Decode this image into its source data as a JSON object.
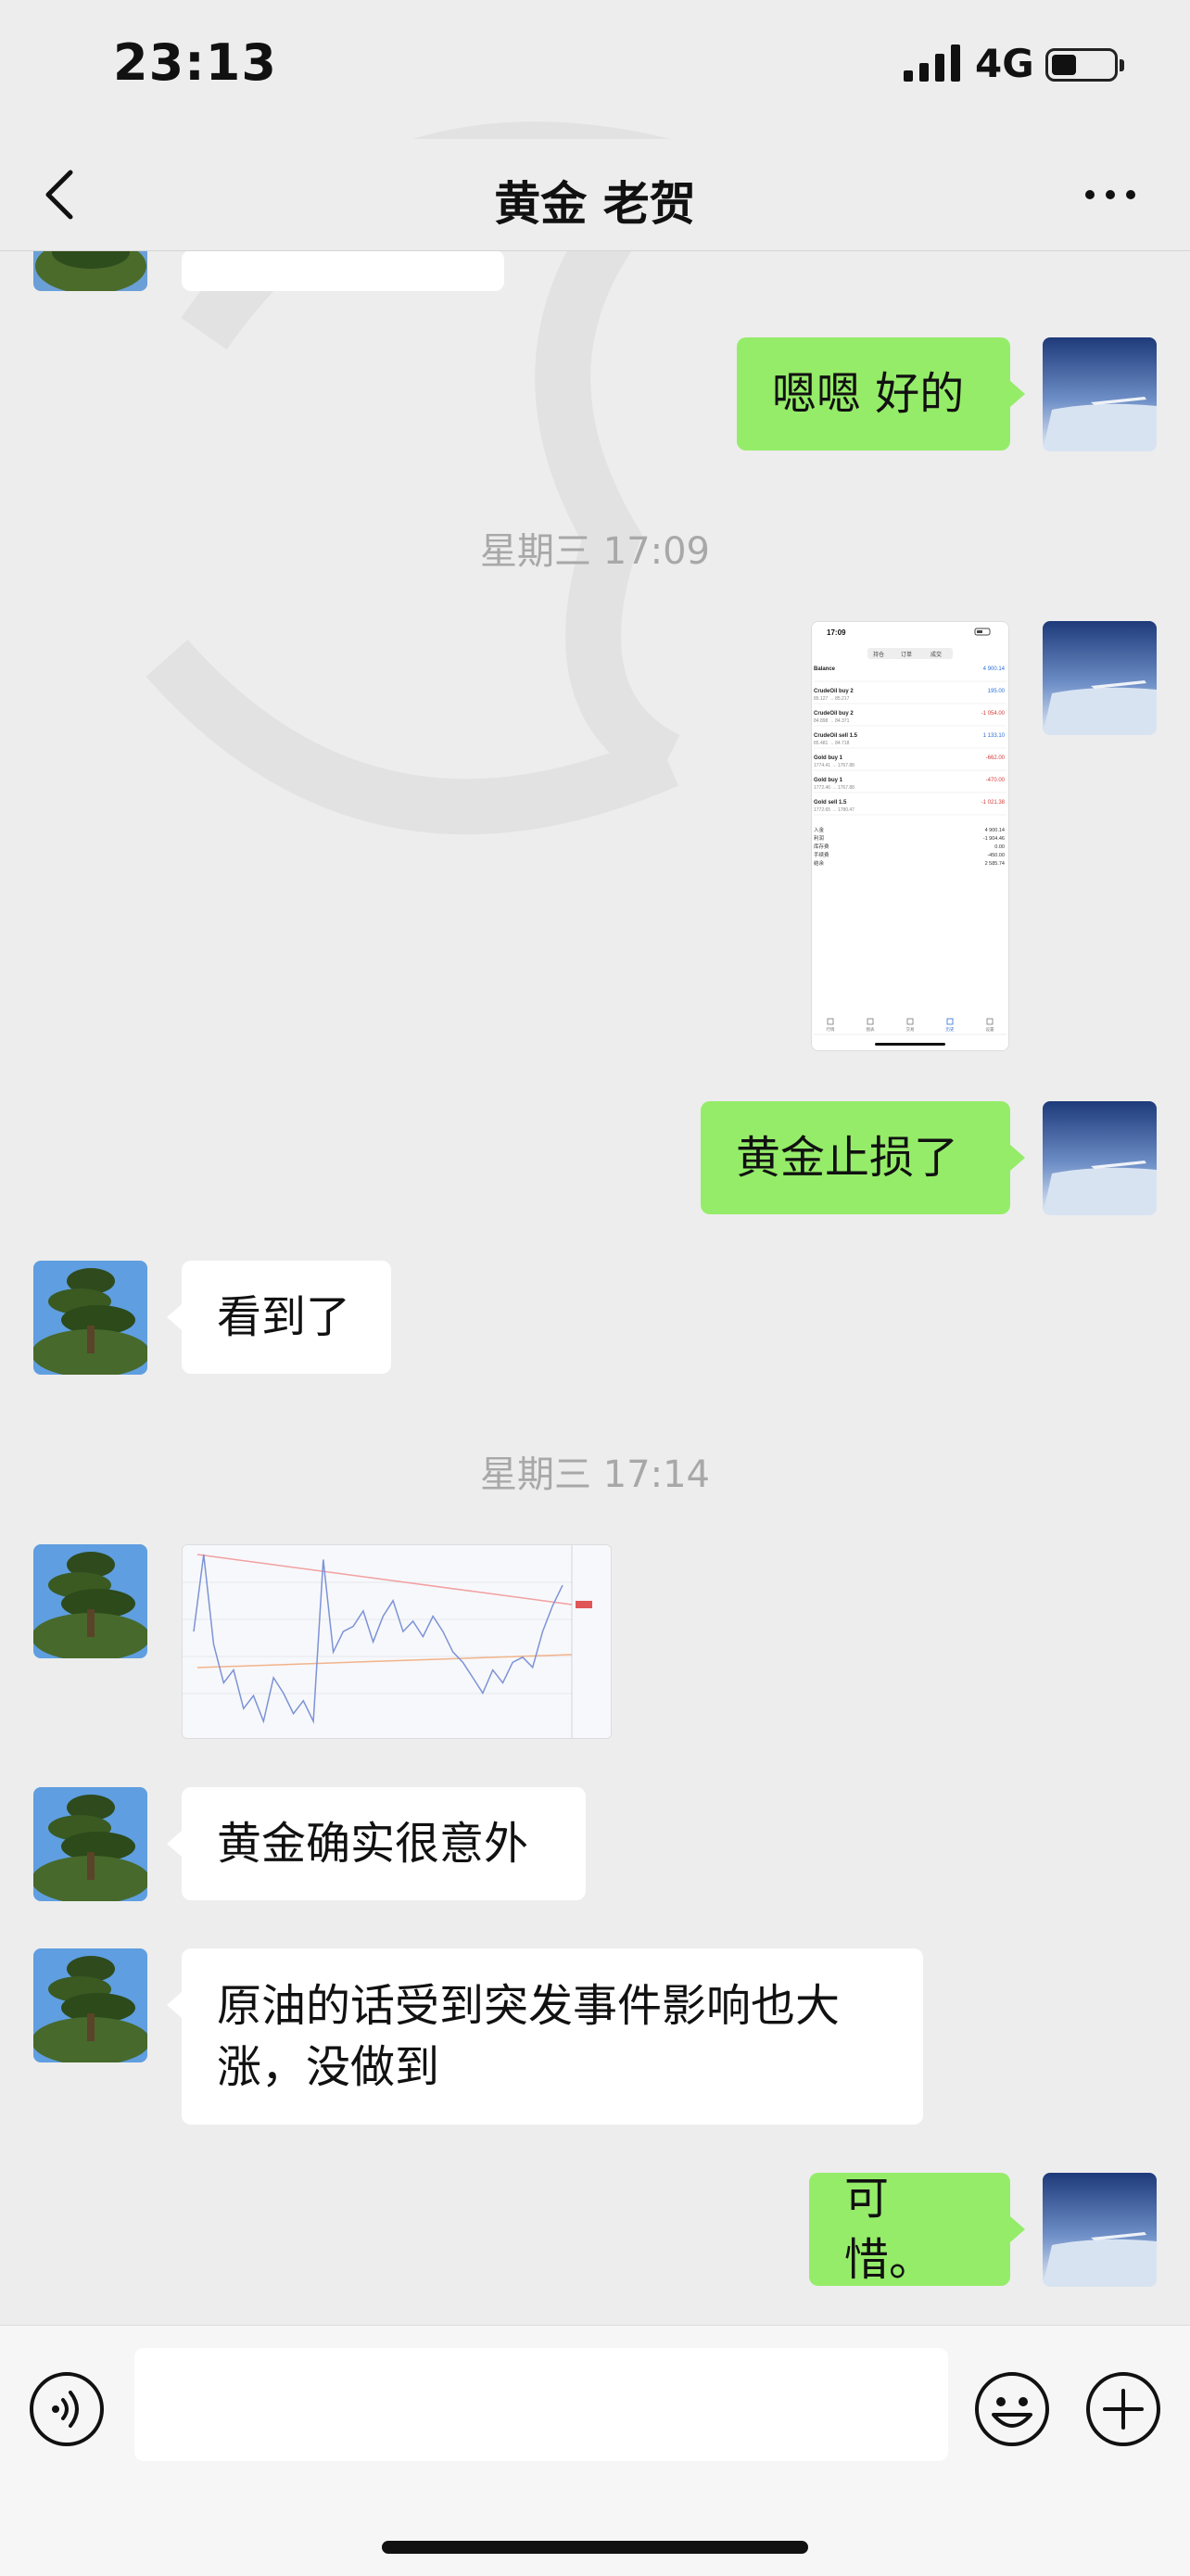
{
  "status": {
    "time": "23:13",
    "network": "4G"
  },
  "nav": {
    "title": "黄金 老贺"
  },
  "messages": {
    "m1": "嗯嗯 好的",
    "t1": "星期三 17:09",
    "m3": "黄金止损了",
    "m4": "看到了",
    "t2": "星期三 17:14",
    "m6": "黄金确实很意外",
    "m7": "原油的话受到突发事件影响也大涨，没做到",
    "m8": "可惜。"
  },
  "screenshot": {
    "time": "17:09",
    "tabs": [
      "持仓",
      "订单",
      "成交"
    ],
    "rows": [
      {
        "name": "Balance",
        "sub": "",
        "val": "4 900.14"
      },
      {
        "name": "CrudeOil buy 2",
        "sub": "85.127 → 85.217",
        "val": "195.00"
      },
      {
        "name": "CrudeOil buy 2",
        "sub": "84.898 → 84.371",
        "val": "-1 054.00"
      },
      {
        "name": "CrudeOil sell 1.5",
        "sub": "85.481 → 84.718",
        "val": "1 133.10"
      },
      {
        "name": "Gold buy 1",
        "sub": "1774.41 → 1767.88",
        "val": "-662.00"
      },
      {
        "name": "Gold buy 1",
        "sub": "1772.46 → 1767.88",
        "val": "-470.00"
      },
      {
        "name": "Gold sell 1.5",
        "sub": "1772.65 → 1780.47",
        "val": "-1 021.38"
      }
    ],
    "summary": [
      {
        "label": "入金",
        "val": "4 900.14"
      },
      {
        "label": "利润",
        "val": "-1 904.46"
      },
      {
        "label": "库存费",
        "val": "0.00"
      },
      {
        "label": "手续费",
        "val": "-450.00"
      },
      {
        "label": "结余",
        "val": "2 585.74"
      }
    ],
    "bottom_tabs": [
      "行情",
      "图表",
      "交易",
      "历史",
      "设置"
    ]
  },
  "chart_data": {
    "type": "line",
    "title": "",
    "xlabel": "",
    "ylabel": "",
    "series": [
      {
        "values": [
          1760,
          1790,
          1755,
          1740,
          1745,
          1730,
          1735,
          1725,
          1742,
          1736,
          1728,
          1733,
          1725,
          1788,
          1752,
          1760,
          1762,
          1768,
          1756,
          1766,
          1772,
          1760,
          1764,
          1758,
          1766,
          1760,
          1752,
          1748,
          1742,
          1736,
          1745,
          1740,
          1748,
          1750,
          1746,
          1760,
          1770,
          1778
        ]
      }
    ]
  },
  "input": {
    "placeholder": ""
  }
}
